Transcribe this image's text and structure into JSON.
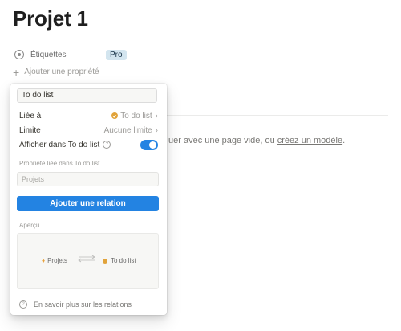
{
  "page": {
    "title": "Projet 1"
  },
  "properties": [
    {
      "name": "Étiquettes",
      "icon": "tag-select-icon",
      "value": "Pro"
    }
  ],
  "add_property_label": "Ajouter une propriété",
  "empty_state": {
    "text_before": "uer avec une page vide, ou ",
    "link": "créez un modèle",
    "text_after": "."
  },
  "relation_popup": {
    "name_value": "To do list",
    "linked_label": "Liée à",
    "linked_value": "To do list",
    "limit_label": "Limite",
    "limit_value": "Aucune limite",
    "show_in_label": "Afficher dans To do list",
    "show_in_enabled": true,
    "linked_prop_label": "Propriété liée dans To do list",
    "linked_prop_placeholder": "Projets",
    "add_button": "Ajouter une relation",
    "preview_label": "Aperçu",
    "preview_left": "Projets",
    "preview_right": "To do list",
    "footer_link": "En savoir plus sur les relations",
    "accent_color": "#2383e2"
  }
}
